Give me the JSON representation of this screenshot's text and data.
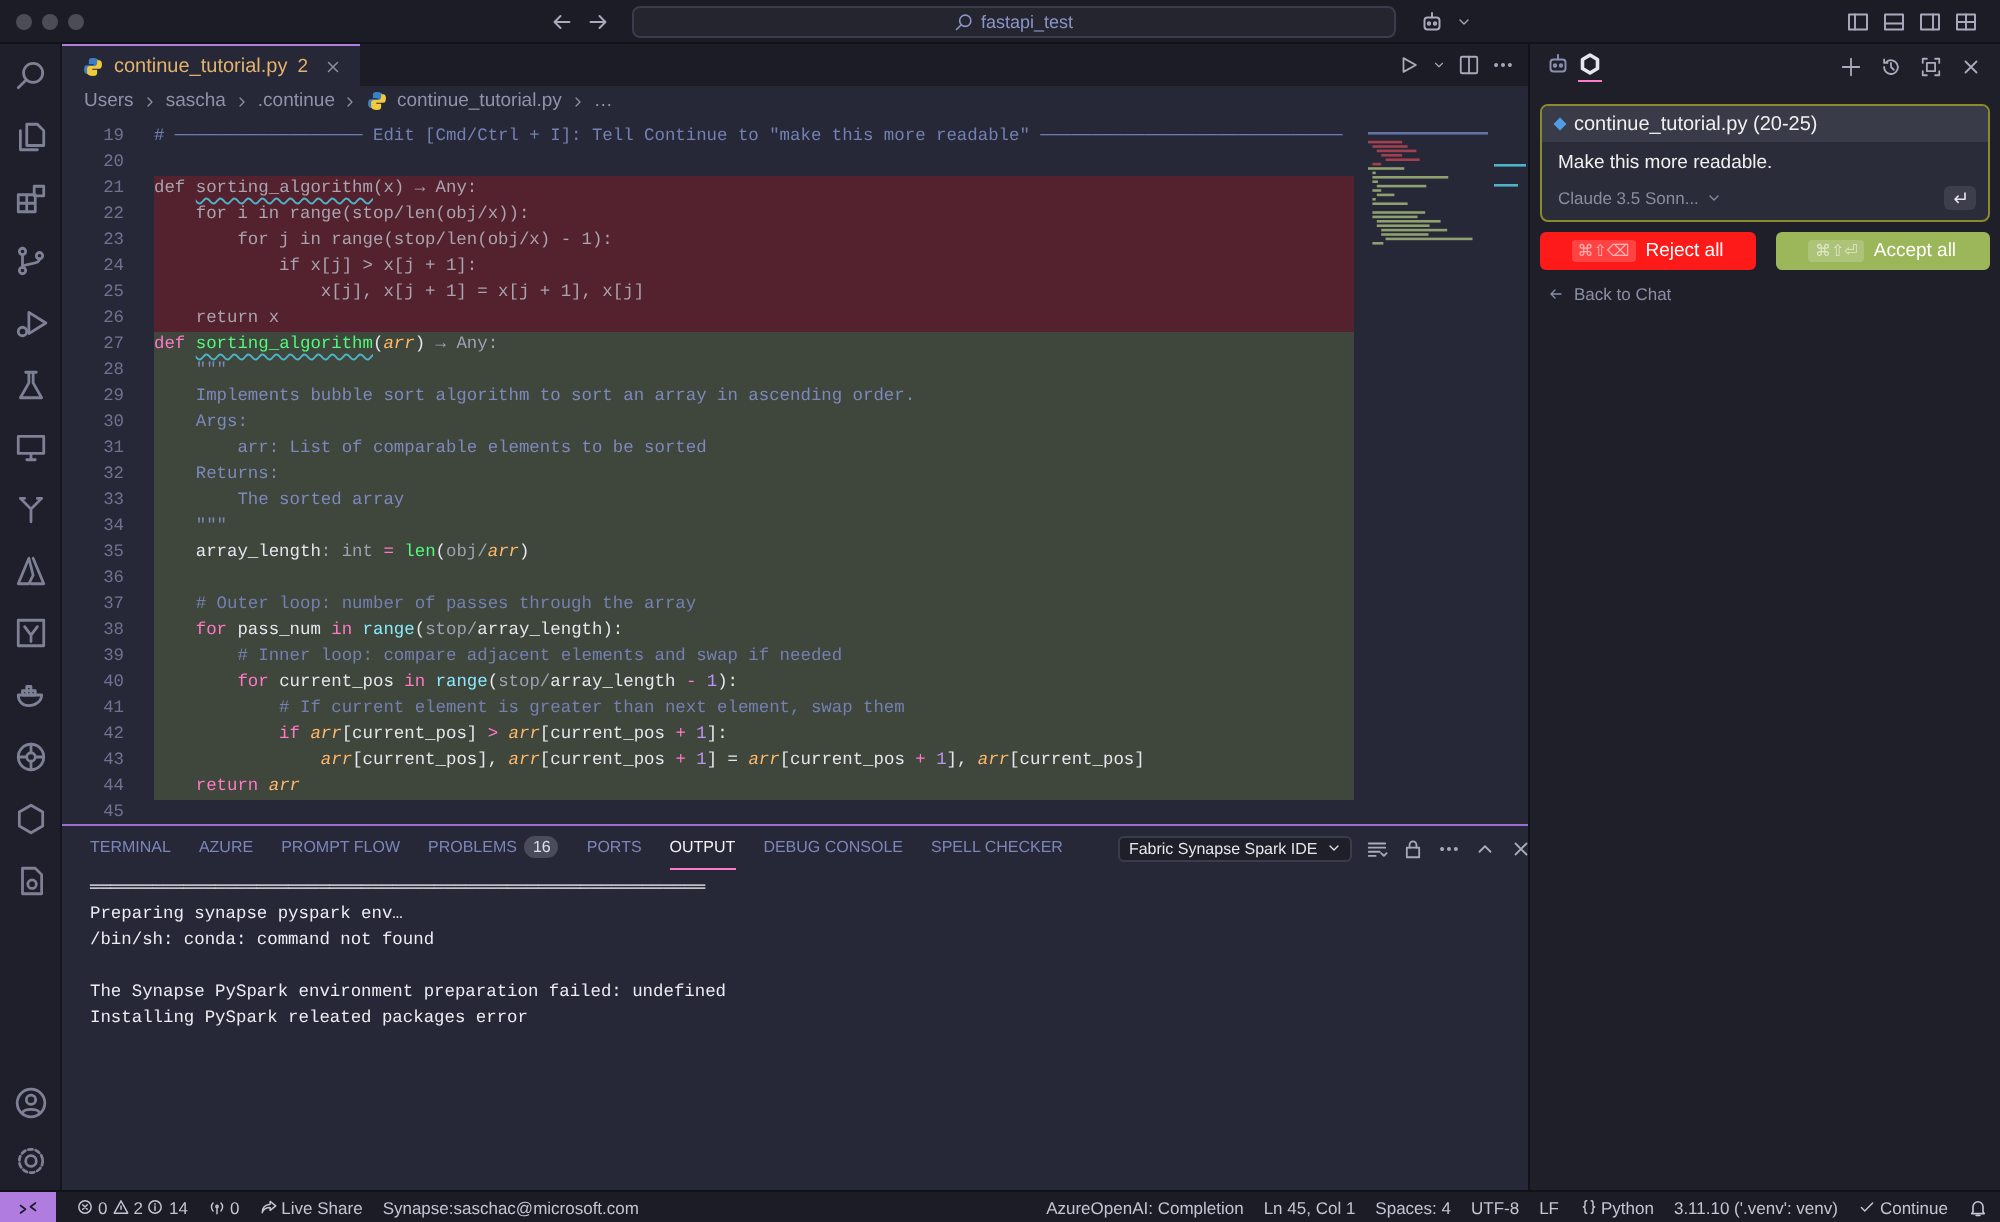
{
  "title_bar": {
    "search": "fastapi_test"
  },
  "editor": {
    "tabs": [
      {
        "label": "continue_tutorial.py",
        "badge": "2",
        "selected": true
      }
    ],
    "breadcrumb": [
      {
        "label": "Users",
        "kind": "folder"
      },
      {
        "label": "sascha",
        "kind": "folder"
      },
      {
        "label": ".continue",
        "kind": "folder"
      },
      {
        "label": "continue_tutorial.py",
        "kind": "file"
      },
      {
        "label": "…",
        "kind": "folder"
      }
    ],
    "lines": [
      {
        "number": "19",
        "kind": "context",
        "tokens": [
          {
            "text": "# ────────────────── Edit [Cmd/Ctrl + I]: Tell Continue to \"make this more readable\" ─────────────────────────────",
            "kind": "comment"
          }
        ]
      },
      {
        "number": "20",
        "kind": "context"
      },
      {
        "number": "21",
        "kind": "removed",
        "tokens": [
          {
            "text": "def ",
            "kind": "plain"
          },
          {
            "text": "sorting_algorithm",
            "kind": "squiggle"
          },
          {
            "text": "(x) → Any:",
            "kind": "plain"
          }
        ]
      },
      {
        "number": "22",
        "kind": "removed",
        "tokens": [
          {
            "text": "    for i in range(stop/len(obj/x)):",
            "kind": "plain"
          }
        ]
      },
      {
        "number": "23",
        "kind": "removed",
        "tokens": [
          {
            "text": "        for j in range(stop/len(obj/x) - 1):",
            "kind": "plain"
          }
        ]
      },
      {
        "number": "24",
        "kind": "removed",
        "tokens": [
          {
            "text": "            if x[j] > x[j + 1]:",
            "kind": "plain"
          }
        ]
      },
      {
        "number": "25",
        "kind": "removed",
        "tokens": [
          {
            "text": "                x[j], x[j + 1] = x[j + 1], x[j]",
            "kind": "plain"
          }
        ]
      },
      {
        "number": "26",
        "kind": "removed",
        "tokens": [
          {
            "text": "    return x",
            "kind": "plain"
          }
        ]
      },
      {
        "number": "27",
        "kind": "added",
        "tokens": [
          {
            "text": "def ",
            "kind": "keyword"
          },
          {
            "text": "sorting_algorithm",
            "kind": "squiggle"
          },
          {
            "text": "(",
            "kind": "plain"
          },
          {
            "text": "arr",
            "kind": "param"
          },
          {
            "text": ") ",
            "kind": "plain"
          },
          {
            "text": "→ Any:",
            "kind": "hint"
          }
        ]
      },
      {
        "number": "28",
        "kind": "added",
        "tokens": [
          {
            "text": "    \"\"\"",
            "kind": "docstring"
          }
        ]
      },
      {
        "number": "29",
        "kind": "added",
        "tokens": [
          {
            "text": "    Implements bubble sort algorithm to sort an array in ascending order.",
            "kind": "docstring"
          }
        ]
      },
      {
        "number": "30",
        "kind": "added",
        "tokens": [
          {
            "text": "    Args:",
            "kind": "docstring"
          }
        ]
      },
      {
        "number": "31",
        "kind": "added",
        "tokens": [
          {
            "text": "        arr: List of comparable elements to be sorted",
            "kind": "docstring"
          }
        ]
      },
      {
        "number": "32",
        "kind": "added",
        "tokens": [
          {
            "text": "    Returns:",
            "kind": "docstring"
          }
        ]
      },
      {
        "number": "33",
        "kind": "added",
        "tokens": [
          {
            "text": "        The sorted array",
            "kind": "docstring"
          }
        ]
      },
      {
        "number": "34",
        "kind": "added",
        "tokens": [
          {
            "text": "    \"\"\"",
            "kind": "docstring"
          }
        ]
      },
      {
        "number": "35",
        "kind": "added",
        "tokens": [
          {
            "text": "    array_length",
            "kind": "plain"
          },
          {
            "text": ": int",
            "kind": "hint"
          },
          {
            "text": " = ",
            "kind": "operator"
          },
          {
            "text": "len",
            "kind": "function"
          },
          {
            "text": "(",
            "kind": "plain"
          },
          {
            "text": "obj/",
            "kind": "hint"
          },
          {
            "text": "arr",
            "kind": "param"
          },
          {
            "text": ")",
            "kind": "plain"
          }
        ]
      },
      {
        "number": "36",
        "kind": "added"
      },
      {
        "number": "37",
        "kind": "added",
        "tokens": [
          {
            "text": "    # Outer loop: number of passes through the array",
            "kind": "comment"
          }
        ]
      },
      {
        "number": "38",
        "kind": "added",
        "tokens": [
          {
            "text": "    for",
            "kind": "keyword"
          },
          {
            "text": " pass_num ",
            "kind": "plain"
          },
          {
            "text": "in ",
            "kind": "keyword"
          },
          {
            "text": "range",
            "kind": "builtin"
          },
          {
            "text": "(",
            "kind": "plain"
          },
          {
            "text": "stop/",
            "kind": "hint"
          },
          {
            "text": "array_length):",
            "kind": "plain"
          }
        ]
      },
      {
        "number": "39",
        "kind": "added",
        "tokens": [
          {
            "text": "        # Inner loop: compare adjacent elements and swap if needed",
            "kind": "comment"
          }
        ]
      },
      {
        "number": "40",
        "kind": "added",
        "tokens": [
          {
            "text": "        for",
            "kind": "keyword"
          },
          {
            "text": " current_pos ",
            "kind": "plain"
          },
          {
            "text": "in ",
            "kind": "keyword"
          },
          {
            "text": "range",
            "kind": "builtin"
          },
          {
            "text": "(",
            "kind": "plain"
          },
          {
            "text": "stop/",
            "kind": "hint"
          },
          {
            "text": "array_length ",
            "kind": "plain"
          },
          {
            "text": "- ",
            "kind": "operator"
          },
          {
            "text": "1",
            "kind": "number"
          },
          {
            "text": "):",
            "kind": "plain"
          }
        ]
      },
      {
        "number": "41",
        "kind": "added",
        "tokens": [
          {
            "text": "            # If current element is greater than next element, swap them",
            "kind": "comment"
          }
        ]
      },
      {
        "number": "42",
        "kind": "added",
        "tokens": [
          {
            "text": "            if ",
            "kind": "keyword"
          },
          {
            "text": "arr",
            "kind": "param"
          },
          {
            "text": "[current_pos] ",
            "kind": "plain"
          },
          {
            "text": "> ",
            "kind": "operator"
          },
          {
            "text": "arr",
            "kind": "param"
          },
          {
            "text": "[current_pos ",
            "kind": "plain"
          },
          {
            "text": "+ ",
            "kind": "operator"
          },
          {
            "text": "1",
            "kind": "number"
          },
          {
            "text": "]:",
            "kind": "plain"
          }
        ]
      },
      {
        "number": "43",
        "kind": "added",
        "tokens": [
          {
            "text": "                arr",
            "kind": "param"
          },
          {
            "text": "[current_pos], ",
            "kind": "plain"
          },
          {
            "text": "arr",
            "kind": "param"
          },
          {
            "text": "[current_pos ",
            "kind": "plain"
          },
          {
            "text": "+ ",
            "kind": "operator"
          },
          {
            "text": "1",
            "kind": "number"
          },
          {
            "text": "] = ",
            "kind": "plain"
          },
          {
            "text": "arr",
            "kind": "param"
          },
          {
            "text": "[current_pos ",
            "kind": "plain"
          },
          {
            "text": "+ ",
            "kind": "operator"
          },
          {
            "text": "1",
            "kind": "number"
          },
          {
            "text": "], ",
            "kind": "plain"
          },
          {
            "text": "arr",
            "kind": "param"
          },
          {
            "text": "[current_pos]",
            "kind": "plain"
          }
        ]
      },
      {
        "number": "44",
        "kind": "added",
        "tokens": [
          {
            "text": "    return ",
            "kind": "keyword"
          },
          {
            "text": "arr",
            "kind": "param"
          }
        ]
      },
      {
        "number": "45",
        "kind": "context"
      }
    ]
  },
  "panel": {
    "tabs": [
      {
        "label": "TERMINAL",
        "selected": false
      },
      {
        "label": "AZURE",
        "selected": false
      },
      {
        "label": "PROMPT FLOW",
        "selected": false
      },
      {
        "label": "PROBLEMS",
        "badge": "16",
        "selected": false
      },
      {
        "label": "PORTS",
        "selected": false
      },
      {
        "label": "OUTPUT",
        "selected": true
      },
      {
        "label": "DEBUG CONSOLE",
        "selected": false
      },
      {
        "label": "SPELL CHECKER",
        "selected": false
      }
    ],
    "dropdown": "Fabric Synapse Spark IDE",
    "output": [
      {
        "lines": [
          "═══════════════════════════════════════════════════════════",
          "Preparing synapse pyspark env…",
          "/bin/sh: conda: command not found"
        ]
      },
      {
        "lines": [
          "The Synapse PySpark environment preparation failed: undefined",
          "Installing PySpark releated packages error"
        ]
      }
    ]
  },
  "chat": {
    "tabs": [
      {
        "kind": "robot",
        "selected": false
      },
      {
        "kind": "continue",
        "selected": true
      }
    ],
    "context": "continue_tutorial.py (20-25)",
    "prompt": "Make this more readable.",
    "model": "Claude 3.5 Sonn...",
    "reject": {
      "shortcut": "⌘⇧⌫",
      "label": "Reject all"
    },
    "accept": {
      "shortcut": "⌘⇧⏎",
      "label": "Accept all"
    },
    "back": "Back to Chat"
  },
  "status_bar": {
    "left": [
      {
        "kind": "remote"
      },
      {
        "kind": "problems",
        "errors": "0",
        "warnings": "2",
        "infos": "14"
      },
      {
        "kind": "ports",
        "text": "0"
      },
      {
        "kind": "liveshare",
        "text": "Live Share"
      },
      {
        "kind": "text",
        "text": "Synapse:saschac@microsoft.com"
      }
    ],
    "right": [
      {
        "kind": "text",
        "text": "AzureOpenAI: Completion"
      },
      {
        "kind": "text",
        "text": "Ln 45, Col 1"
      },
      {
        "kind": "text",
        "text": "Spaces: 4"
      },
      {
        "kind": "text",
        "text": "UTF-8"
      },
      {
        "kind": "text",
        "text": "LF"
      },
      {
        "kind": "language",
        "text": "Python"
      },
      {
        "kind": "text",
        "text": "3.11.10 ('.venv': venv)"
      },
      {
        "kind": "check",
        "text": "Continue"
      },
      {
        "kind": "bell"
      }
    ]
  }
}
